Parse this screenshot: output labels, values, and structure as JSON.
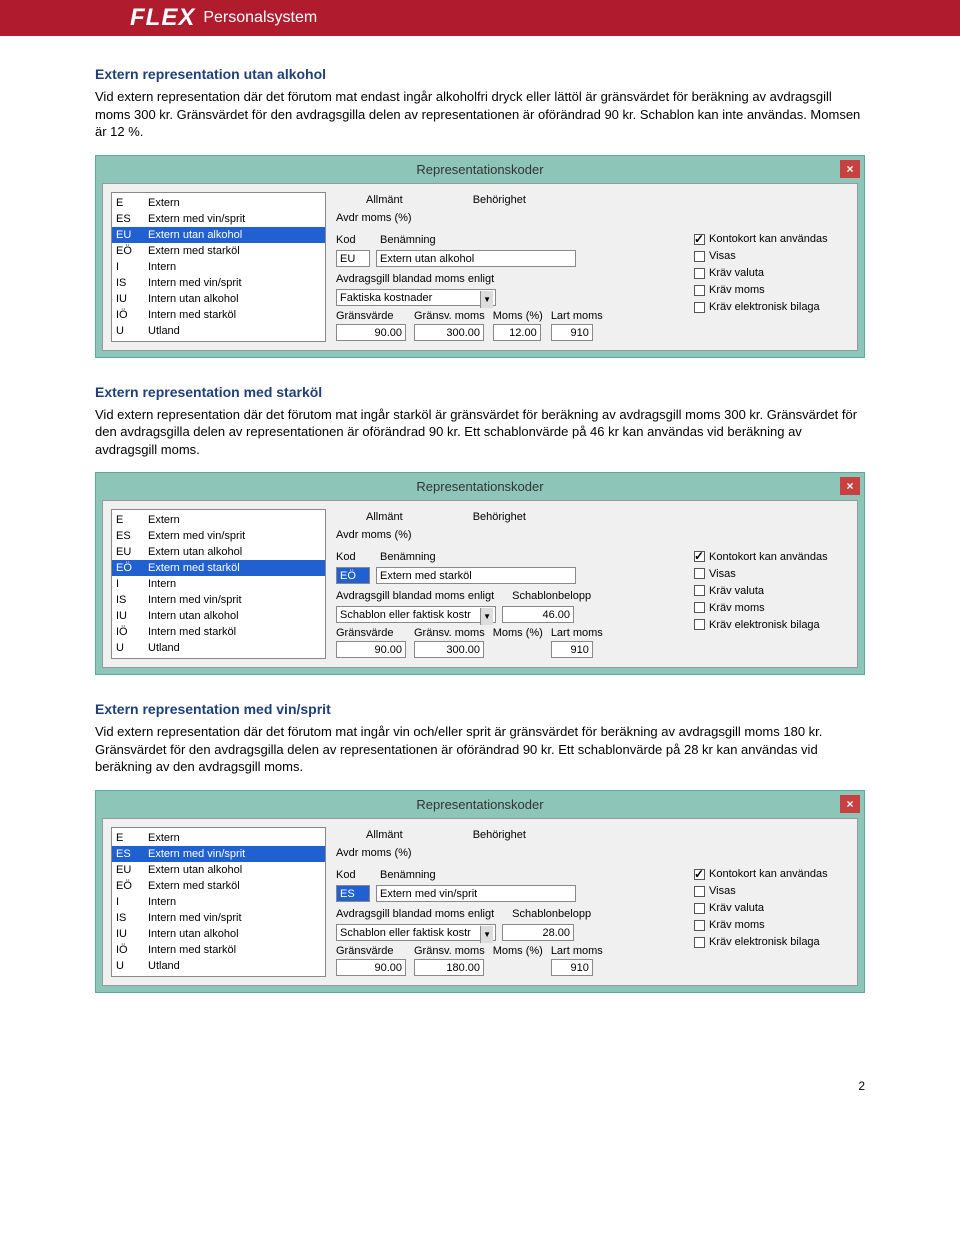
{
  "header": {
    "brand": "FLEX",
    "subtitle": "Personalsystem"
  },
  "page_number": "2",
  "dialog_title": "Representationskoder",
  "close_glyph": "×",
  "codes": [
    {
      "code": "E",
      "label": "Extern"
    },
    {
      "code": "ES",
      "label": "Extern med vin/sprit"
    },
    {
      "code": "EU",
      "label": "Extern utan alkohol"
    },
    {
      "code": "EÖ",
      "label": "Extern med starköl"
    },
    {
      "code": "I",
      "label": "Intern"
    },
    {
      "code": "IS",
      "label": "Intern med vin/sprit"
    },
    {
      "code": "IU",
      "label": "Intern utan alkohol"
    },
    {
      "code": "IÖ",
      "label": "Intern med starköl"
    },
    {
      "code": "U",
      "label": "Utland"
    }
  ],
  "tabs": {
    "allmant": "Allmänt",
    "behorighet": "Behörighet"
  },
  "labels": {
    "vat_pct": "Avdr moms (%)",
    "kod": "Kod",
    "benamning": "Benämning",
    "avdr_bland": "Avdragsgill blandad moms enligt",
    "schablon": "Schablonbelopp",
    "gransvarde": "Gränsvärde",
    "gransv_moms": "Gränsv. moms",
    "moms_pct": "Moms (%)",
    "lart_moms": "Lart moms"
  },
  "checks": {
    "kontokort": "Kontokort kan användas",
    "visas": "Visas",
    "krav_valuta": "Kräv valuta",
    "krav_moms": "Kräv moms",
    "krav_bilaga": "Kräv elektronisk bilaga"
  },
  "sections": [
    {
      "title": "Extern representation utan alkohol",
      "text": "Vid extern representation där det förutom mat endast ingår alkoholfri dryck eller lättöl är gränsvärdet för beräkning av avdragsgill moms 300 kr. Gränsvärdet för den avdragsgilla delen av representationen är oförändrad 90 kr. Schablon kan inte användas. Momsen är 12 %.",
      "form": {
        "selected_index": 2,
        "kod": "EU",
        "benamning": "Extern utan alkohol",
        "avdr_dd": "Faktiska kostnader",
        "has_schablon": false,
        "schablon": "",
        "gransvarde": "90.00",
        "gransv_moms": "300.00",
        "has_moms_pct": true,
        "moms_pct": "12.00",
        "lart_moms": "910",
        "kod_sel": false
      }
    },
    {
      "title": "Extern representation med starköl",
      "text": "Vid extern representation där det förutom mat ingår starköl är gränsvärdet för beräkning av avdragsgill moms 300 kr. Gränsvärdet för den avdragsgilla delen av representationen är oförändrad 90 kr. Ett schablonvärde på 46 kr kan användas vid beräkning av avdragsgill moms.",
      "form": {
        "selected_index": 3,
        "kod": "EÖ",
        "benamning": "Extern med starköl",
        "avdr_dd": "Schablon eller faktisk kostr",
        "has_schablon": true,
        "schablon": "46.00",
        "gransvarde": "90.00",
        "gransv_moms": "300.00",
        "has_moms_pct": false,
        "moms_pct": "",
        "lart_moms": "910",
        "kod_sel": true
      }
    },
    {
      "title": "Extern representation med vin/sprit",
      "text": "Vid extern representation där det förutom mat ingår vin och/eller sprit är gränsvärdet för beräkning av avdragsgill moms 180 kr. Gränsvärdet för den avdragsgilla delen av representationen är oförändrad 90 kr. Ett schablonvärde på 28 kr kan användas vid beräkning av den avdragsgill moms.",
      "form": {
        "selected_index": 1,
        "kod": "ES",
        "benamning": "Extern med vin/sprit",
        "avdr_dd": "Schablon eller faktisk kostr",
        "has_schablon": true,
        "schablon": "28.00",
        "gransvarde": "90.00",
        "gransv_moms": "180.00",
        "has_moms_pct": false,
        "moms_pct": "",
        "lart_moms": "910",
        "kod_sel": true
      }
    }
  ]
}
